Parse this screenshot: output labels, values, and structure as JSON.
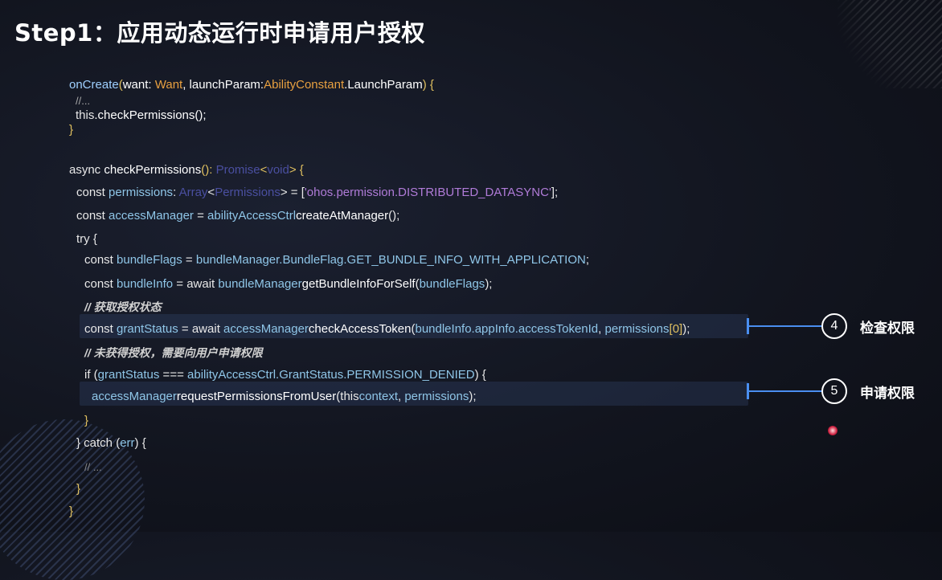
{
  "title": "Step1：应用动态运行时申请用户授权",
  "code": {
    "l1": {
      "a": "onCreate",
      "b": "(",
      "c": "want: ",
      "d": "Want",
      ",": ", launchParam:",
      "e": "AbilityConstant",
      "f": ".LaunchParam",
      ")": ") {"
    },
    "l2": "//...",
    "l3": {
      "a": "this",
      "b": ".checkPermissions();"
    },
    "l4": "}",
    "l5": {
      "a": "async ",
      "b": "checkPermissions",
      "c": "(): ",
      "d": "Promise",
      "e": "<",
      "f": "void",
      "g": "> {"
    },
    "l6": {
      "a": "const ",
      "b": "permissions",
      "c": ": ",
      "d": "Array",
      "e": "<",
      "f": "Permissions",
      "g": "> = [",
      "h": "'ohos.permission.DISTRIBUTED_DATASYNC'",
      "i": "];"
    },
    "l7": {
      "a": "const ",
      "b": "accessManager",
      "c": " = ",
      "d": "abilityAccessCtrl",
      ".": ".",
      "e": "createAtManager",
      "f": "();"
    },
    "l8": "try {",
    "l9": {
      "a": "const ",
      "b": "bundleFlags",
      "c": " = ",
      "d": "bundleManager",
      "e": ".BundleFlag.",
      "f": "GET_BUNDLE_INFO_WITH_APPLICATION",
      "g": ";"
    },
    "l10": {
      "a": "const ",
      "b": "bundleInfo",
      "c": " = await ",
      "d": "bundleManager",
      ".": ".",
      "e": "getBundleInfoForSelf",
      "f": "(",
      "g": "bundleFlags",
      "h": ");"
    },
    "l11": "// 获取授权状态",
    "l12": {
      "a": "const ",
      "b": "grantStatus",
      "c": " = await ",
      "d": "accessManager",
      ".": ".",
      "e": "checkAccessToken",
      "f": "(",
      "g": "bundleInfo.appInfo.accessTokenId",
      ",": ", ",
      "h": "permissions",
      "i": "[0]",
      ")": ");"
    },
    "l13": "// 未获得授权，需要向用户申请权限",
    "l14": {
      "a": "if (",
      "b": "grantStatus",
      "c": " === ",
      "d": "abilityAccessCtrl",
      "e": ".GrantStatus.",
      "f": "PERMISSION_DENIED",
      "g": ") {"
    },
    "l15": {
      "a": "accessManager",
      ".": ".",
      "b": "requestPermissionsFromUser",
      "c": "(",
      "d": "this",
      "e": "context",
      ",": ", ",
      "f": "permissions",
      "g": ");"
    },
    "l16": "}",
    "l17": {
      "a": "} catch (",
      "b": "err",
      "c": ") {"
    },
    "l18": "// ...",
    "l19": "}",
    "l20": "}"
  },
  "annotations": [
    {
      "num": "4",
      "label": "检查权限"
    },
    {
      "num": "5",
      "label": "申请权限"
    }
  ]
}
